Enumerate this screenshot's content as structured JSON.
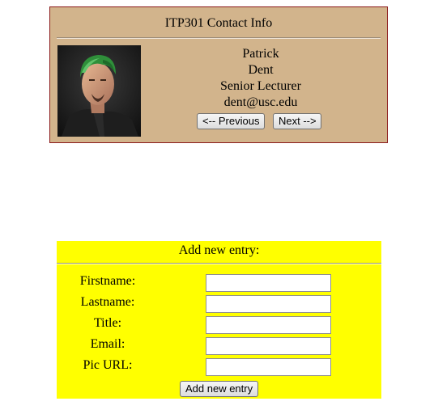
{
  "contact_card": {
    "title": "ITP301 Contact Info",
    "firstname": "Patrick",
    "lastname": "Dent",
    "job_title": "Senior Lecturer",
    "email": "dent@usc.edu",
    "prev_label": "<-- Previous",
    "next_label": "Next -->",
    "photo_icon": "person-photo",
    "colors": {
      "background": "#d2b48c",
      "border": "#8b1a1a"
    }
  },
  "add_form": {
    "title": "Add new entry:",
    "fields": [
      {
        "label": "Firstname:",
        "value": "",
        "placeholder": ""
      },
      {
        "label": "Lastname:",
        "value": "",
        "placeholder": ""
      },
      {
        "label": "Title:",
        "value": "",
        "placeholder": ""
      },
      {
        "label": "Email:",
        "value": "",
        "placeholder": ""
      },
      {
        "label": "Pic URL:",
        "value": "",
        "placeholder": ""
      }
    ],
    "submit_label": "Add new entry",
    "colors": {
      "background": "#ffff00"
    }
  }
}
